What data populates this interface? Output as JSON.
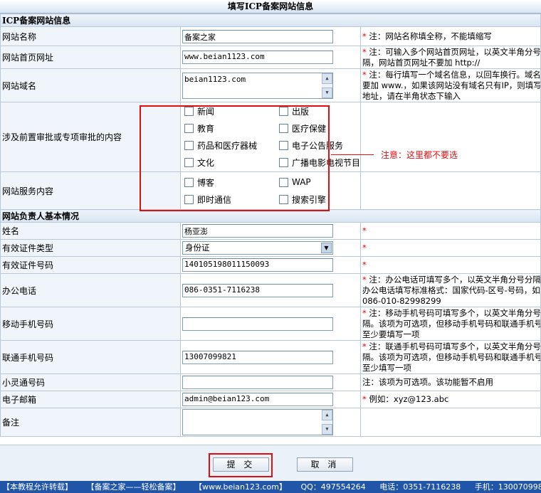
{
  "page_title": "填写ICP备案网站信息",
  "section_site": "ICP备案网站信息",
  "site_name": {
    "label": "网站名称",
    "value": "备案之家",
    "note": "* 注：网站名称填全称，不能填缩写"
  },
  "site_url": {
    "label": "网站首页网址",
    "value": "www.beian1123.com",
    "note_line1": "* 注：可输入多个网站首页网址，以英文半角分号分",
    "note_line2": "隔，网站首页网址不要加 http://"
  },
  "site_domain": {
    "label": "网站域名",
    "value": "beian1123.com",
    "note_line1": "* 注：每行填写一个域名信息，以回车换行。域名不",
    "note_line2": "要加 www.，如果该网站没有域名只有IP，则填写IP",
    "note_line3": "地址，请在半角状态下输入"
  },
  "approval": {
    "label": "涉及前置审批或专项审批的内容",
    "options": [
      "新闻",
      "出版",
      "教育",
      "医疗保健",
      "药品和医疗器械",
      "电子公告服务",
      "文化",
      "广播电影电视节目"
    ]
  },
  "service": {
    "label": "网站服务内容",
    "options": [
      "博客",
      "WAP",
      "即时通信",
      "搜索引擎"
    ]
  },
  "annotation": "注意：这里都不要选",
  "section_person": "网站负责人基本情况",
  "person_name": {
    "label": "姓名",
    "value": "杨亚澎",
    "note": "*"
  },
  "id_type": {
    "label": "有效证件类型",
    "value": "身份证",
    "note": "*"
  },
  "id_number": {
    "label": "有效证件号码",
    "value": "140105198011150093",
    "note": "*"
  },
  "office_phone": {
    "label": "办公电话",
    "value": "086-0351-7116238",
    "note_line1": "* 注：办公电话可填写多个，以英文半角分号分隔。",
    "note_line2": "办公电话填写标准格式：国家代码-区号-号码，如：",
    "note_line3": "086-010-82998299"
  },
  "mobile": {
    "label": "移动手机号码",
    "value": "",
    "note_line1": "* 注：移动手机号码可填写多个，以英文半角分号分",
    "note_line2": "隔。该项为可选项，但移动手机号码和联通手机号码",
    "note_line3": "至少要填写一项"
  },
  "unicom": {
    "label": "联通手机号码",
    "value": "13007099821",
    "note_line1": "* 注：联通手机号码可填写多个，以英文半角分号分",
    "note_line2": "隔。该项为可选项，但移动手机号码和联通手机号码",
    "note_line3": "至少填写一项"
  },
  "phs": {
    "label": "小灵通号码",
    "value": "",
    "note": "注：该项为可选项。该功能暂不启用"
  },
  "email": {
    "label": "电子邮箱",
    "value": "admin@beian123.com",
    "note": "* 例如：xyz@123.abc"
  },
  "remark": {
    "label": "备注",
    "value": ""
  },
  "submit_label": "提 交",
  "cancel_label": "取 消",
  "footer": [
    "【本教程允许转载】",
    "【备案之家——轻松备案】",
    "【www.beian123.com】",
    "QQ：497554264",
    "电话：0351-7116238",
    "手机：13007099821"
  ],
  "colors": {
    "accent_red": "#e01010",
    "footer_bg": "#2055a8",
    "label_bg": "#eff5fb"
  }
}
